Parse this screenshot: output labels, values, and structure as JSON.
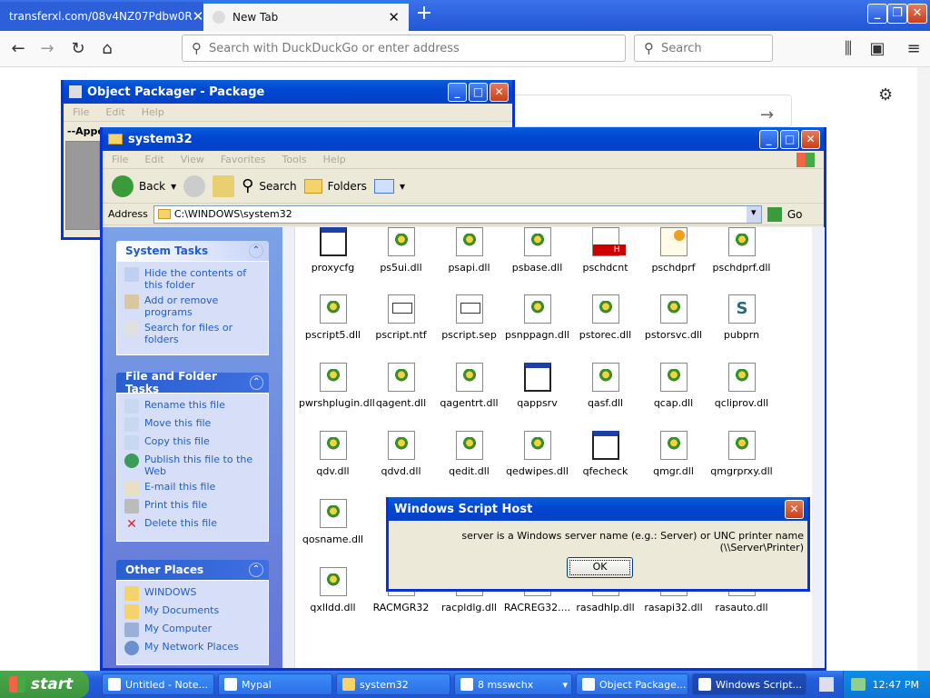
{
  "firefox": {
    "tabs": [
      {
        "label": "transferxl.com/08v4NZ07Pdbw0R"
      },
      {
        "label": "New Tab"
      }
    ],
    "tab_close_glyph": "✕",
    "new_tab_glyph": "+",
    "address_placeholder": "Search with DuckDuckGo or enter address",
    "search_placeholder": "Search"
  },
  "packager": {
    "title": "Object Packager - Package",
    "menu": [
      "File",
      "Edit",
      "Help"
    ],
    "content_label": "--Appe"
  },
  "explorer": {
    "title": "system32",
    "menu": [
      "File",
      "Edit",
      "View",
      "Favorites",
      "Tools",
      "Help"
    ],
    "toolbar": {
      "back": "Back",
      "search": "Search",
      "folders": "Folders"
    },
    "address_label": "Address",
    "address_value": "C:\\WINDOWS\\system32",
    "go_label": "Go",
    "system_tasks": {
      "header": "System Tasks",
      "items": [
        "Hide the contents of this folder",
        "Add or remove programs",
        "Search for files or folders"
      ]
    },
    "file_tasks": {
      "header": "File and Folder Tasks",
      "items": [
        "Rename this file",
        "Move this file",
        "Copy this file",
        "Publish this file to the Web",
        "E-mail this file",
        "Print this file",
        "Delete this file"
      ]
    },
    "other_places": {
      "header": "Other Places",
      "items": [
        "WINDOWS",
        "My Documents",
        "My Computer",
        "My Network Places"
      ]
    },
    "files": [
      {
        "name": "proxycfg",
        "icon": "window"
      },
      {
        "name": "ps5ui.dll",
        "icon": "dll"
      },
      {
        "name": "psapi.dll",
        "icon": "dll"
      },
      {
        "name": "psbase.dll",
        "icon": "dll"
      },
      {
        "name": "pschdcnt",
        "icon": "header"
      },
      {
        "name": "pschdprf",
        "icon": "cert"
      },
      {
        "name": "pschdprf.dll",
        "icon": "dll"
      },
      {
        "name": "pscript5.dll",
        "icon": "dll"
      },
      {
        "name": "pscript.ntf",
        "icon": "text"
      },
      {
        "name": "pscript.sep",
        "icon": "text"
      },
      {
        "name": "psnppagn.dll",
        "icon": "dll"
      },
      {
        "name": "pstorec.dll",
        "icon": "dll"
      },
      {
        "name": "pstorsvc.dll",
        "icon": "dll"
      },
      {
        "name": "pubprn",
        "icon": "script"
      },
      {
        "name": "pwrshplugin.dll",
        "icon": "dll"
      },
      {
        "name": "qagent.dll",
        "icon": "dll"
      },
      {
        "name": "qagentrt.dll",
        "icon": "dll"
      },
      {
        "name": "qappsrv",
        "icon": "window"
      },
      {
        "name": "qasf.dll",
        "icon": "dll"
      },
      {
        "name": "qcap.dll",
        "icon": "dll"
      },
      {
        "name": "qcliprov.dll",
        "icon": "dll"
      },
      {
        "name": "qdv.dll",
        "icon": "dll"
      },
      {
        "name": "qdvd.dll",
        "icon": "dll"
      },
      {
        "name": "qedit.dll",
        "icon": "dll"
      },
      {
        "name": "qedwipes.dll",
        "icon": "dll"
      },
      {
        "name": "qfecheck",
        "icon": "window"
      },
      {
        "name": "qmgr.dll",
        "icon": "dll"
      },
      {
        "name": "qmgrprxy.dll",
        "icon": "dll"
      },
      {
        "name": "qosname.dll",
        "icon": "dll"
      },
      {
        "name": "qxlldd.dll",
        "icon": "dll"
      },
      {
        "name": "RACMGR32",
        "icon": "dll"
      },
      {
        "name": "racpldlg.dll",
        "icon": "dll"
      },
      {
        "name": "RACREG32....",
        "icon": "dll"
      },
      {
        "name": "rasadhlp.dll",
        "icon": "dll"
      },
      {
        "name": "rasapi32.dll",
        "icon": "dll"
      },
      {
        "name": "rasauto.dll",
        "icon": "dll"
      }
    ]
  },
  "dialog": {
    "title": "Windows Script Host",
    "message": "server is a Windows server name (e.g.: Server) or UNC printer name (\\\\Server\\Printer)",
    "ok": "OK"
  },
  "taskbar": {
    "start": "start",
    "items": [
      "Untitled - Note...",
      "Mypal",
      "system32",
      "8  msswchx",
      "Object Package...",
      "Windows Script..."
    ],
    "clock": "12:47 PM"
  }
}
